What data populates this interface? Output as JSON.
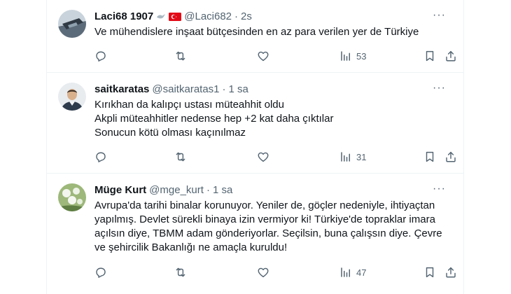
{
  "tweets": [
    {
      "name": "Laci68 1907",
      "handle": "@Laci682",
      "time": "2s",
      "text_lines": [
        "Ve mühendislere inşaat bütçesinden en az para verilen yer de Türkiye"
      ],
      "views": "53"
    },
    {
      "name": "saitkaratas",
      "handle": "@saitkaratas1",
      "time": "1 sa",
      "text_lines": [
        "Kırıkhan da kalıpçı ustası müteahhit oldu",
        "Akpli müteahhitler nedense hep +2 kat daha çıktılar",
        "Sonucun kötü olması kaçınılmaz"
      ],
      "views": "31"
    },
    {
      "name": "Müge Kurt",
      "handle": "@mge_kurt",
      "time": "1 sa",
      "text_lines": [
        "Avrupa'da tarihi binalar korunuyor. Yeniler de, göçler nedeniyle, ihtiyaçtan",
        "yapılmış. Devlet sürekli binaya izin vermiyor ki! Türkiye'de topraklar imara",
        "açılsın diye, TBMM adam gönderiyorlar. Seçilsin, buna çalışsın diye. Çevre",
        "ve şehircilik Bakanlığı ne amaçla kuruldu!"
      ],
      "views": "47"
    }
  ],
  "dot": "·",
  "more_glyph": "···",
  "colors": {
    "text": "#0f1419",
    "muted": "#536471",
    "divider": "#eff3f4",
    "flag": "#e30a17"
  }
}
